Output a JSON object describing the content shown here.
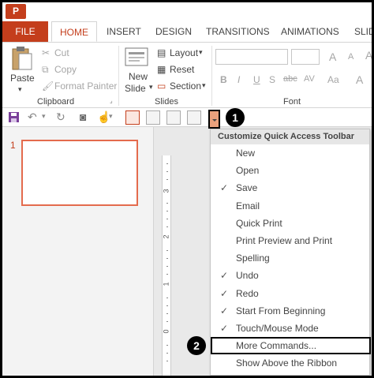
{
  "app": {
    "logo": "P"
  },
  "tabs": [
    "FILE",
    "HOME",
    "INSERT",
    "DESIGN",
    "TRANSITIONS",
    "ANIMATIONS",
    "SLID"
  ],
  "ribbon": {
    "clipboard": {
      "paste": "Paste",
      "cut": "Cut",
      "copy": "Copy",
      "format_painter": "Format Painter",
      "label": "Clipboard"
    },
    "slides": {
      "new_slide_1": "New",
      "new_slide_2": "Slide",
      "layout": "Layout",
      "reset": "Reset",
      "section": "Section",
      "label": "Slides"
    },
    "font": {
      "label": "Font",
      "buttons": [
        "B",
        "I",
        "U",
        "S",
        "abc",
        "AV",
        "Aa",
        "A"
      ]
    }
  },
  "qat": {
    "dropdown_badge": "1"
  },
  "thumbnails": {
    "slide_number": "1"
  },
  "ruler": {
    "numbers": [
      "3",
      "2",
      "1",
      "0"
    ]
  },
  "menu": {
    "header": "Customize Quick Access Toolbar",
    "items": [
      {
        "label": "New",
        "checked": false
      },
      {
        "label": "Open",
        "checked": false
      },
      {
        "label": "Save",
        "checked": true
      },
      {
        "label": "Email",
        "checked": false
      },
      {
        "label": "Quick Print",
        "checked": false
      },
      {
        "label": "Print Preview and Print",
        "checked": false
      },
      {
        "label": "Spelling",
        "checked": false
      },
      {
        "label": "Undo",
        "checked": true
      },
      {
        "label": "Redo",
        "checked": true
      },
      {
        "label": "Start From Beginning",
        "checked": true
      },
      {
        "label": "Touch/Mouse Mode",
        "checked": true
      },
      {
        "label": "More Commands...",
        "checked": false
      },
      {
        "label": "Show Above the Ribbon",
        "checked": false
      }
    ],
    "more_commands_badge": "2",
    "check_glyph": "✓"
  },
  "colors": {
    "accent": "#c43e1c",
    "highlight": "#e9a07c"
  },
  "icons": [
    "save-icon",
    "undo-icon",
    "redo-icon",
    "start-from-beginning-icon",
    "touch-mode-icon",
    "normal-view-icon",
    "outline-view-icon",
    "slide-sorter-icon",
    "reading-view-icon"
  ]
}
